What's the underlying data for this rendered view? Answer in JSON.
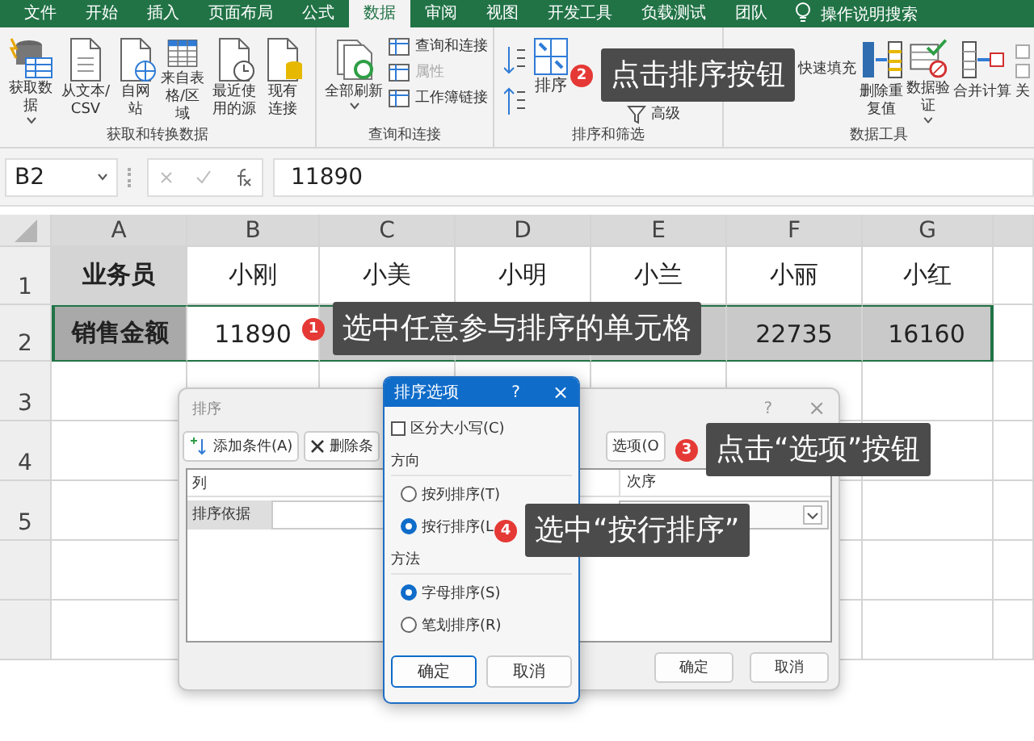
{
  "ribbon": {
    "tabs": [
      {
        "label": "文件",
        "selected": false
      },
      {
        "label": "开始",
        "selected": false
      },
      {
        "label": "插入",
        "selected": false
      },
      {
        "label": "页面布局",
        "selected": false
      },
      {
        "label": "公式",
        "selected": false
      },
      {
        "label": "数据",
        "selected": true
      },
      {
        "label": "审阅",
        "selected": false
      },
      {
        "label": "视图",
        "selected": false
      },
      {
        "label": "开发工具",
        "selected": false
      },
      {
        "label": "负载测试",
        "selected": false
      },
      {
        "label": "团队",
        "selected": false
      }
    ],
    "search": "操作说明搜索",
    "groups": [
      {
        "label": "获取和转换数据",
        "items": [
          {
            "label": "获取数据",
            "kind": "large",
            "dropdown": true
          },
          {
            "label": "从文本/CSV",
            "kind": "large"
          },
          {
            "label": "自网站",
            "kind": "large"
          },
          {
            "label": "来自表格/区域",
            "kind": "large"
          },
          {
            "label": "最近使用的源",
            "kind": "large"
          },
          {
            "label": "现有连接",
            "kind": "large"
          }
        ]
      },
      {
        "label": "查询和连接",
        "items": [
          {
            "label": "全部刷新",
            "kind": "large",
            "dropdown": true
          },
          {
            "label": "查询和连接",
            "kind": "small",
            "disabled": false
          },
          {
            "label": "属性",
            "kind": "small",
            "disabled": true
          },
          {
            "label": "工作簿链接",
            "kind": "small",
            "disabled": false
          }
        ]
      },
      {
        "label": "排序和筛选",
        "items": [
          {
            "kind": "sort-pair"
          },
          {
            "label": "排序",
            "kind": "large"
          },
          {
            "label": "高级",
            "kind": "small"
          }
        ]
      },
      {
        "label": "数据工具",
        "items": [
          {
            "label": "快速填充",
            "kind": "small"
          },
          {
            "label": "删除重复值",
            "kind": "large"
          },
          {
            "label": "数据验证",
            "kind": "large",
            "dropdown": true
          },
          {
            "label": "合并计算",
            "kind": "large"
          },
          {
            "label": "关",
            "kind": "large"
          }
        ]
      }
    ]
  },
  "formula_bar": {
    "name_box": "B2",
    "value": "11890"
  },
  "sheet": {
    "columns": [
      "A",
      "B",
      "C",
      "D",
      "E",
      "F",
      "G"
    ],
    "rows": [
      {
        "number": "1",
        "cells": [
          {
            "text": "业务员",
            "kind": "label",
            "selected": false
          },
          {
            "text": "小刚",
            "kind": "value",
            "selected": false
          },
          {
            "text": "小美",
            "kind": "value",
            "selected": false
          },
          {
            "text": "小明",
            "kind": "value",
            "selected": false
          },
          {
            "text": "小兰",
            "kind": "value",
            "selected": false
          },
          {
            "text": "小丽",
            "kind": "value",
            "selected": false
          },
          {
            "text": "小红",
            "kind": "value",
            "selected": false
          }
        ]
      },
      {
        "number": "2",
        "cells": [
          {
            "text": "销售金额",
            "kind": "label",
            "selected": true,
            "active": false
          },
          {
            "text": "11890",
            "kind": "value",
            "selected": true,
            "active": true
          },
          {
            "kind": "blank",
            "selected": true,
            "active": false
          },
          {
            "kind": "blank",
            "selected": true,
            "active": false
          },
          {
            "kind": "blank",
            "selected": true,
            "active": false
          },
          {
            "text": "22735",
            "kind": "value",
            "selected": true,
            "active": false
          },
          {
            "text": "16160",
            "kind": "value",
            "selected": true,
            "active": false
          }
        ]
      },
      {
        "number": "3"
      },
      {
        "number": "4"
      },
      {
        "number": "5"
      }
    ]
  },
  "sort_dialog": {
    "title": "排序",
    "help": "?",
    "close": "×",
    "add_button": "添加条件(A)",
    "delete_button": "删除条",
    "options_button": "选项(O",
    "column_header": "列",
    "order_header": "次序",
    "row_label": "排序依据",
    "ok": "确定",
    "cancel": "取消"
  },
  "options_dialog": {
    "title": "排序选项",
    "help": "?",
    "close": "×",
    "case_sensitive": {
      "label": "区分大小写(C)",
      "checked": false
    },
    "orientation": {
      "label": "方向",
      "options": [
        {
          "label": "按列排序(T)",
          "selected": false
        },
        {
          "label": "按行排序(L",
          "selected": true
        }
      ]
    },
    "method": {
      "label": "方法",
      "options": [
        {
          "label": "字母排序(S)",
          "selected": true
        },
        {
          "label": "笔划排序(R)",
          "selected": false
        }
      ]
    },
    "ok": "确定",
    "cancel": "取消"
  },
  "callouts": [
    {
      "number": "2",
      "text": "点击排序按钮"
    },
    {
      "number": "1",
      "text": "选中任意参与排序的单元格"
    },
    {
      "number": "3",
      "text": "点击“选项”按钮"
    },
    {
      "number": "4",
      "text": "选中“按行排序”"
    }
  ]
}
